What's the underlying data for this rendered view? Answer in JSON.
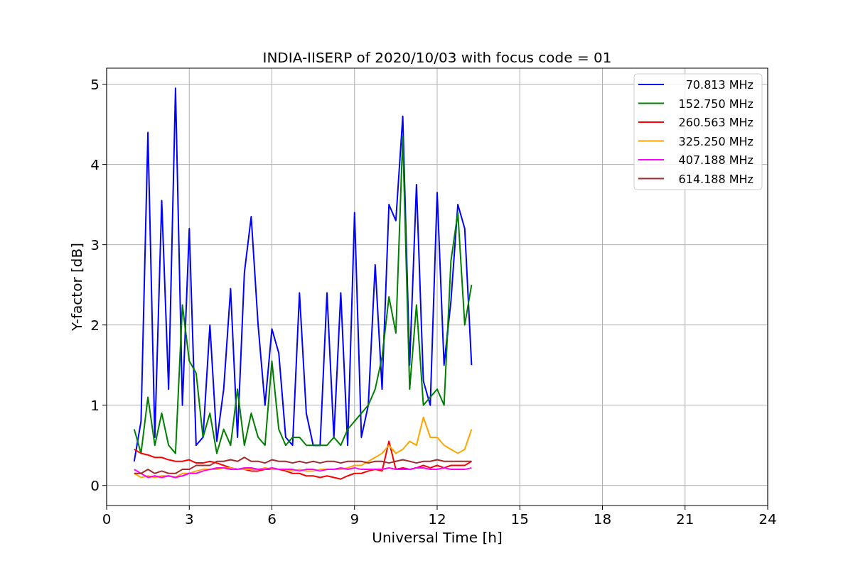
{
  "chart_data": {
    "type": "line",
    "title": "INDIA-IISERP of 2020/10/03 with focus code = 01",
    "xlabel": "Universal Time [h]",
    "ylabel": "Y-factor [dB]",
    "x": [
      1,
      1.25,
      1.5,
      1.75,
      2,
      2.25,
      2.5,
      2.75,
      3,
      3.25,
      3.5,
      3.75,
      4,
      4.25,
      4.5,
      4.75,
      5,
      5.25,
      5.5,
      5.75,
      6,
      6.25,
      6.5,
      6.75,
      7,
      7.25,
      7.5,
      7.75,
      8,
      8.25,
      8.5,
      8.75,
      9,
      9.25,
      9.5,
      9.75,
      10,
      10.25,
      10.5,
      10.75,
      11,
      11.25,
      11.5,
      11.75,
      12,
      12.25,
      12.5,
      12.75,
      13,
      13.25
    ],
    "series": [
      {
        "name": "70.813 MHz",
        "color": "#0000ff",
        "values": [
          0.3,
          0.8,
          4.4,
          0.6,
          3.55,
          1.2,
          4.95,
          1.0,
          3.2,
          0.5,
          0.6,
          2.0,
          0.55,
          1.2,
          2.45,
          0.6,
          2.65,
          3.35,
          2.0,
          1.0,
          1.95,
          1.65,
          0.6,
          0.5,
          2.4,
          0.9,
          0.5,
          0.5,
          2.4,
          0.6,
          2.4,
          0.5,
          3.4,
          0.6,
          1.0,
          2.75,
          1.2,
          3.5,
          3.3,
          4.6,
          1.5,
          3.75,
          1.3,
          1.0,
          3.65,
          1.5,
          2.3,
          3.5,
          3.2,
          1.5
        ]
      },
      {
        "name": "152.750 MHz",
        "color": "#008000",
        "values": [
          0.7,
          0.4,
          1.1,
          0.5,
          0.9,
          0.5,
          0.4,
          2.25,
          1.55,
          1.4,
          0.6,
          0.9,
          0.4,
          0.7,
          0.5,
          1.2,
          0.5,
          0.9,
          0.6,
          0.5,
          1.55,
          0.7,
          0.5,
          0.6,
          0.6,
          0.5,
          0.5,
          0.5,
          0.5,
          0.6,
          0.5,
          0.7,
          0.8,
          0.9,
          1.0,
          1.2,
          1.6,
          2.35,
          1.9,
          4.35,
          1.2,
          2.25,
          1.0,
          1.1,
          1.2,
          1.0,
          2.8,
          3.4,
          2.0,
          2.5
        ]
      },
      {
        "name": "260.563 MHz",
        "color": "#ff0000",
        "values": [
          0.45,
          0.4,
          0.38,
          0.35,
          0.35,
          0.32,
          0.3,
          0.3,
          0.32,
          0.28,
          0.28,
          0.3,
          0.28,
          0.25,
          0.22,
          0.2,
          0.2,
          0.18,
          0.18,
          0.2,
          0.2,
          0.2,
          0.18,
          0.15,
          0.15,
          0.12,
          0.12,
          0.1,
          0.12,
          0.1,
          0.08,
          0.12,
          0.15,
          0.15,
          0.18,
          0.2,
          0.18,
          0.55,
          0.2,
          0.22,
          0.2,
          0.22,
          0.25,
          0.22,
          0.25,
          0.22,
          0.25,
          0.25,
          0.25,
          0.3
        ]
      },
      {
        "name": "325.250 MHz",
        "color": "#ffa500",
        "values": [
          0.15,
          0.1,
          0.12,
          0.1,
          0.12,
          0.12,
          0.1,
          0.15,
          0.15,
          0.18,
          0.2,
          0.2,
          0.2,
          0.22,
          0.22,
          0.2,
          0.2,
          0.2,
          0.2,
          0.22,
          0.2,
          0.2,
          0.2,
          0.18,
          0.2,
          0.18,
          0.18,
          0.2,
          0.2,
          0.2,
          0.2,
          0.22,
          0.25,
          0.25,
          0.3,
          0.35,
          0.4,
          0.5,
          0.4,
          0.45,
          0.55,
          0.5,
          0.85,
          0.6,
          0.6,
          0.5,
          0.45,
          0.4,
          0.45,
          0.7
        ]
      },
      {
        "name": "407.188 MHz",
        "color": "#ff00ff",
        "values": [
          0.2,
          0.15,
          0.1,
          0.12,
          0.1,
          0.12,
          0.1,
          0.12,
          0.15,
          0.15,
          0.18,
          0.2,
          0.22,
          0.22,
          0.2,
          0.2,
          0.22,
          0.22,
          0.2,
          0.2,
          0.22,
          0.2,
          0.2,
          0.2,
          0.18,
          0.2,
          0.2,
          0.18,
          0.2,
          0.2,
          0.22,
          0.2,
          0.22,
          0.2,
          0.2,
          0.2,
          0.2,
          0.22,
          0.2,
          0.2,
          0.2,
          0.22,
          0.22,
          0.2,
          0.2,
          0.22,
          0.2,
          0.2,
          0.2,
          0.22
        ]
      },
      {
        "name": "614.188 MHz",
        "color": "#a52a2a",
        "values": [
          0.15,
          0.15,
          0.2,
          0.15,
          0.18,
          0.15,
          0.15,
          0.2,
          0.2,
          0.25,
          0.25,
          0.25,
          0.3,
          0.3,
          0.32,
          0.3,
          0.35,
          0.3,
          0.3,
          0.28,
          0.32,
          0.3,
          0.3,
          0.28,
          0.3,
          0.28,
          0.3,
          0.28,
          0.3,
          0.3,
          0.28,
          0.3,
          0.3,
          0.3,
          0.28,
          0.3,
          0.3,
          0.28,
          0.3,
          0.32,
          0.3,
          0.28,
          0.3,
          0.3,
          0.32,
          0.3,
          0.3,
          0.3,
          0.3,
          0.3
        ]
      }
    ],
    "grid": true,
    "legend": true,
    "xlim": [
      0,
      24
    ],
    "ylim": [
      -0.25,
      5.2
    ],
    "xticks": [
      0,
      3,
      6,
      9,
      12,
      15,
      18,
      21,
      24
    ],
    "yticks": [
      0,
      1,
      2,
      3,
      4,
      5
    ]
  }
}
